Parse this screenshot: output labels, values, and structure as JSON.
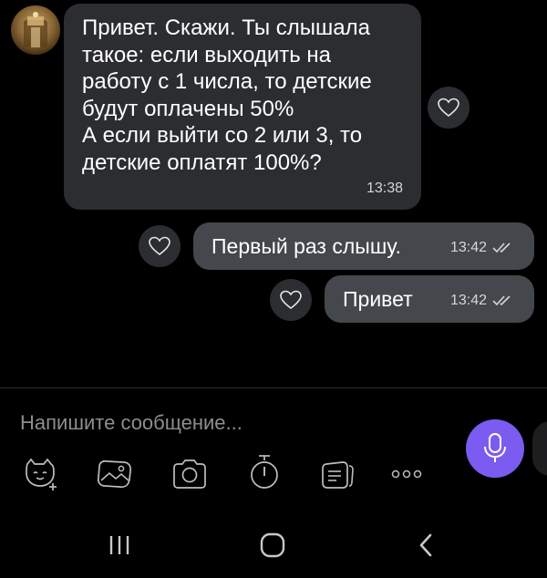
{
  "chat": {
    "incoming": {
      "text": "Привет. Скажи. Ты слышала\nтакое: если выходить на\nработу с 1 числа, то детские\nбудут оплачены 50%\nА если выйти со 2 или  3, то\nдетские оплатят 100%?",
      "time": "13:38"
    },
    "outgoing": [
      {
        "text": "Первый раз слышу.",
        "time": "13:42"
      },
      {
        "text": "Привет",
        "time": "13:42"
      }
    ]
  },
  "composer": {
    "placeholder": "Напишите сообщение...",
    "tools": [
      "sticker-icon",
      "gallery-icon",
      "camera-icon",
      "timer-icon",
      "notes-icon",
      "more-icon"
    ],
    "mic": "microphone-icon",
    "accent": "#7b5bf0"
  },
  "navbar": [
    "recent-apps-icon",
    "home-icon",
    "back-icon"
  ],
  "colors": {
    "incoming_bubble": "#2b2d31",
    "outgoing_bubble": "#44474c",
    "background": "#000000"
  }
}
